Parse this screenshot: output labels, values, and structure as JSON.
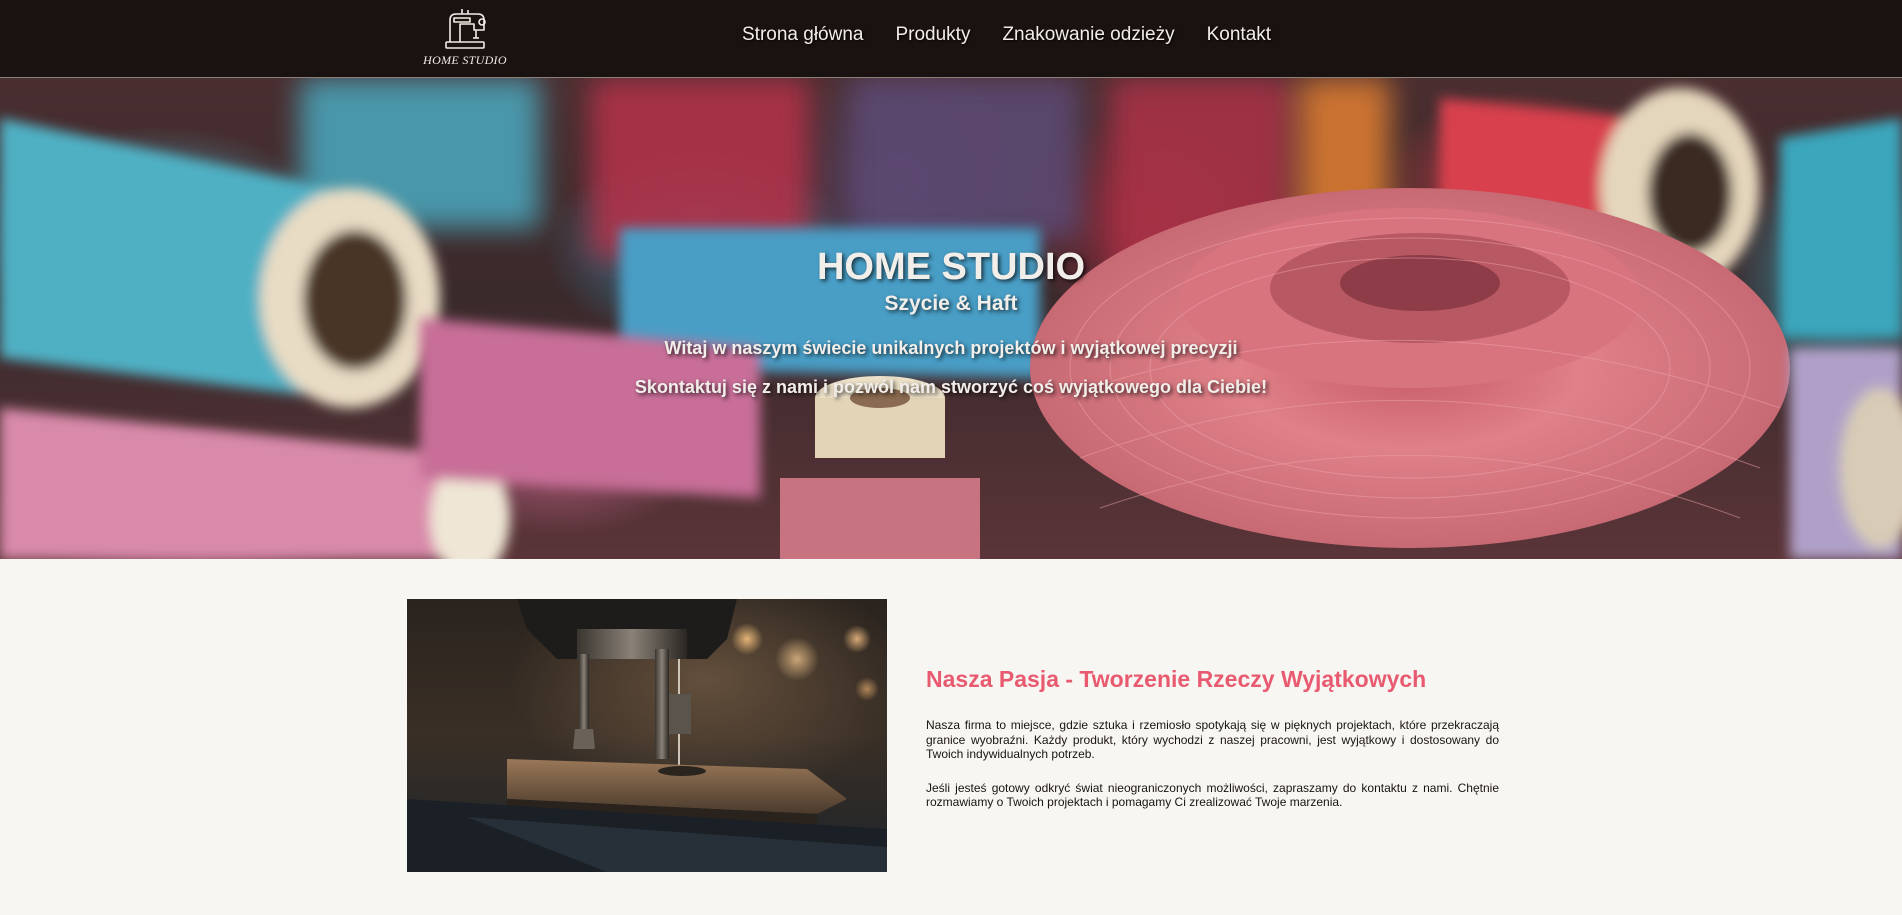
{
  "header": {
    "logo_text": "HOME STUDIO",
    "logo_icon": "sewing-machine-icon",
    "nav": [
      {
        "label": "Strona główna"
      },
      {
        "label": "Produkty"
      },
      {
        "label": "Znakowanie odzieży"
      },
      {
        "label": "Kontakt"
      }
    ]
  },
  "hero": {
    "title": "HOME STUDIO",
    "subtitle": "Szycie & Haft",
    "line1": "Witaj w naszym świecie unikalnych projektów i wyjątkowej precyzji",
    "line2": "Skontaktuj się z nami i pozwól nam stworzyć coś wyjątkowego dla Ciebie!"
  },
  "about": {
    "heading": "Nasza Pasja - Tworzenie Rzeczy Wyjątkowych",
    "paragraphs": [
      "Nasza firma to miejsce, gdzie sztuka i rzemiosło spotykają się w pięknych projektach, które przekraczają granice wyobraźni. Każdy produkt, który wychodzi z naszej pracowni, jest wyjątkowy i dostosowany do Twoich indywidualnych potrzeb.",
      "Jeśli jesteś gotowy odkryć świat nieograniczonych możliwości, zapraszamy do kontaktu z nami. Chętnie rozmawiamy o Twoich projektach i pomagamy Ci zrealizować Twoje marzenia."
    ]
  },
  "colors": {
    "header_bg": "#1a1210",
    "accent_heading": "#e85a70",
    "page_bg": "#f8f6f2"
  }
}
